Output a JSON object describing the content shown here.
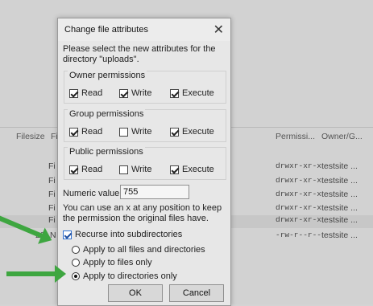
{
  "background": {
    "headers": {
      "filesize": "Filesize",
      "filename_partial": "Fi",
      "permissions": "Permissi...",
      "owner": "Owner/G..."
    },
    "rows": [
      {
        "size": "",
        "name": "Fi",
        "perm": "drwxr-xr-x",
        "owner": "testsite ..."
      },
      {
        "size": "",
        "name": "Fi",
        "perm": "drwxr-xr-x",
        "owner": "testsite ..."
      },
      {
        "size": "",
        "name": "Fi",
        "perm": "drwxr-xr-x",
        "owner": "testsite ..."
      },
      {
        "size": "",
        "name": "Fi",
        "perm": "drwxr-xr-x",
        "owner": "testsite ..."
      },
      {
        "size": "",
        "name": "Fi",
        "perm": "drwxr-xr-x",
        "owner": "testsite ..."
      },
      {
        "size": "28",
        "name": "N",
        "perm": "-rw-r--r--",
        "owner": "testsite ..."
      }
    ]
  },
  "dialog": {
    "title": "Change file attributes",
    "close_glyph": "✕",
    "intro": "Please select the new attributes for the directory \"uploads\".",
    "groups": [
      {
        "title": "Owner permissions",
        "items": [
          {
            "label": "Read",
            "checked": true
          },
          {
            "label": "Write",
            "checked": true
          },
          {
            "label": "Execute",
            "checked": true
          }
        ]
      },
      {
        "title": "Group permissions",
        "items": [
          {
            "label": "Read",
            "checked": true
          },
          {
            "label": "Write",
            "checked": false
          },
          {
            "label": "Execute",
            "checked": true
          }
        ]
      },
      {
        "title": "Public permissions",
        "items": [
          {
            "label": "Read",
            "checked": true
          },
          {
            "label": "Write",
            "checked": false
          },
          {
            "label": "Execute",
            "checked": true
          }
        ]
      }
    ],
    "numeric_label": "Numeric value:",
    "numeric_value": "755",
    "hint": "You can use an x at any position to keep the permission the original files have.",
    "recurse_label": "Recurse into subdirectories",
    "recurse_checked": true,
    "radios": [
      {
        "label": "Apply to all files and directories",
        "selected": false
      },
      {
        "label": "Apply to files only",
        "selected": false
      },
      {
        "label": "Apply to directories only",
        "selected": true
      }
    ],
    "ok_label": "OK",
    "cancel_label": "Cancel"
  },
  "accent_colors": {
    "arrow": "#3ea640",
    "recurse_checkbox": "#2d6fd0"
  }
}
